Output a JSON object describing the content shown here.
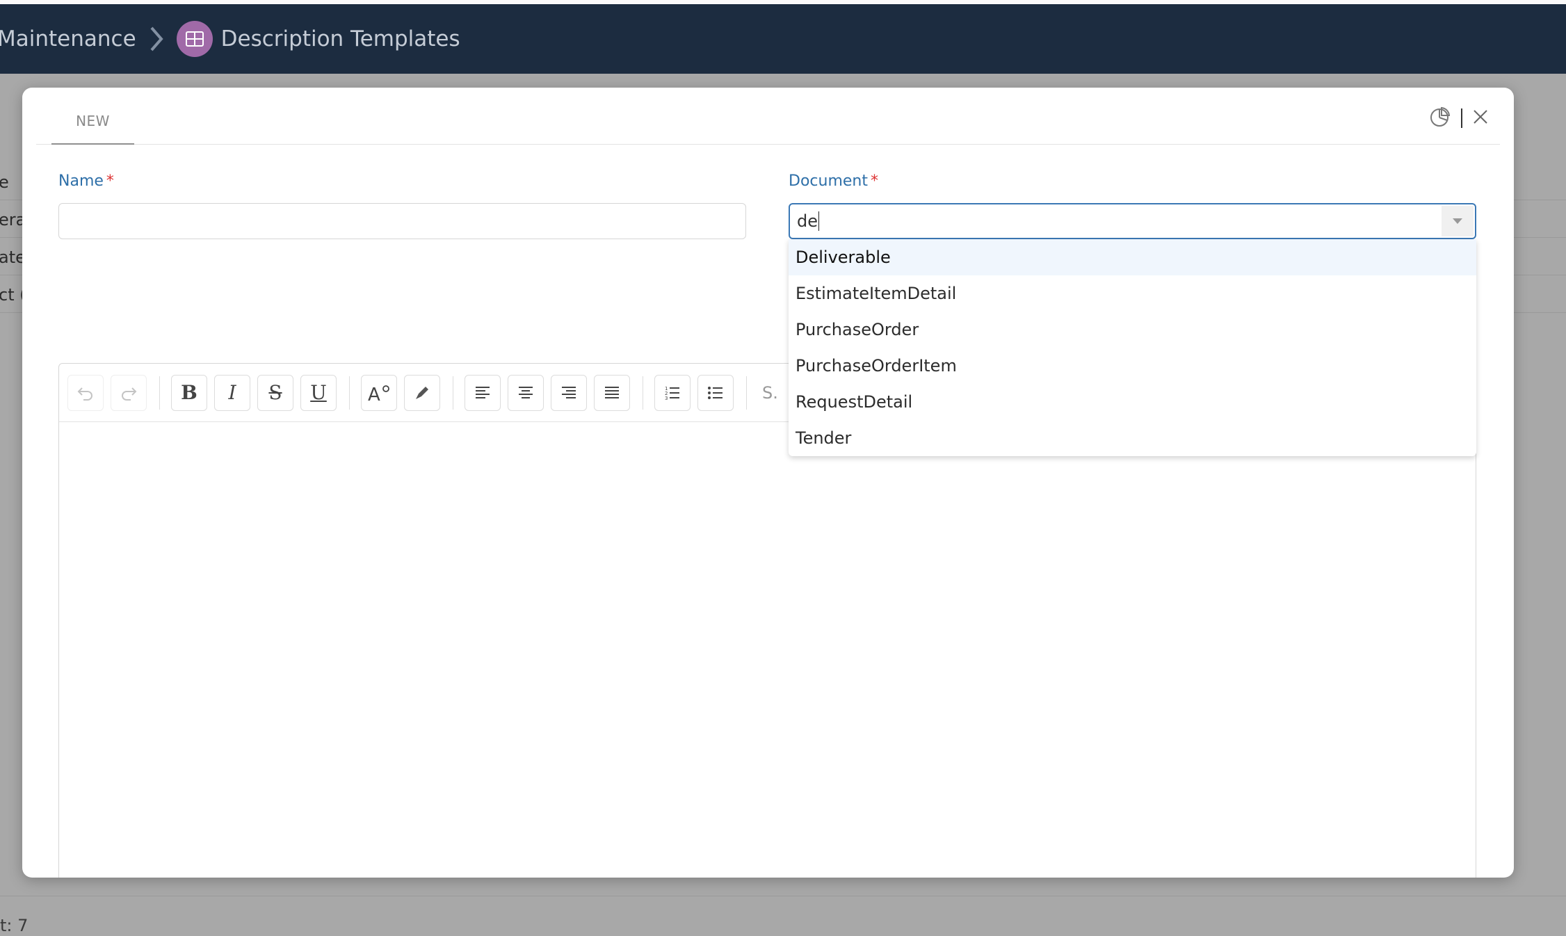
{
  "header": {
    "parent": "Maintenance",
    "current": "Description Templates"
  },
  "background": {
    "rows": [
      "e",
      "eral",
      "ate",
      "ct ("
    ],
    "footer": "t: 7"
  },
  "modal": {
    "tab_new": "NEW",
    "fields": {
      "name_label": "Name",
      "name_value": "",
      "document_label": "Document",
      "document_value": "de",
      "required_mark": "*"
    },
    "dropdown_options": [
      "Deliverable",
      "EstimateItemDetail",
      "PurchaseOrder",
      "PurchaseOrderItem",
      "RequestDetail",
      "Tender"
    ],
    "toolbar": {
      "bold": "B",
      "italic": "I",
      "strike": "S",
      "underline": "U",
      "more": "S."
    }
  },
  "colors": {
    "header_bg": "#1c2c40",
    "label": "#2e6fa8",
    "required": "#dd3333",
    "badge": "#a06aa8",
    "active_border": "#3b78b5"
  }
}
